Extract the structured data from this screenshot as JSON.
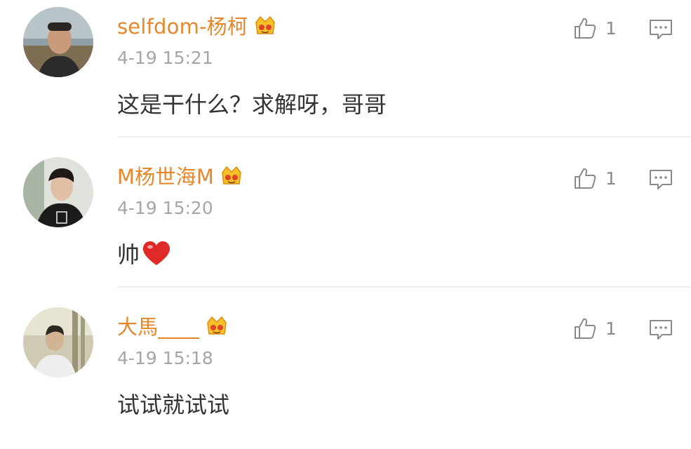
{
  "comments": [
    {
      "user": "selfdom-杨柯",
      "time": "4-19 15:21",
      "text": "这是干什么？求解呀，哥哥",
      "likes": "1",
      "has_heart": false
    },
    {
      "user": "M杨世海M",
      "time": "4-19 15:20",
      "text": "帅",
      "likes": "1",
      "has_heart": true
    },
    {
      "user": "大馬____",
      "time": "4-19 15:18",
      "text": "试试就试试",
      "likes": "1",
      "has_heart": false
    }
  ],
  "icons": {
    "like": "thumbs-up-icon",
    "reply": "comment-icon",
    "badge": "vip-crown-badge",
    "emoji": "heart-icon"
  },
  "colors": {
    "username": "#e8862a",
    "timestamp": "#a6a6a6",
    "text": "#333333",
    "icon": "#8a8a8a",
    "heart": "#e02a2a"
  }
}
